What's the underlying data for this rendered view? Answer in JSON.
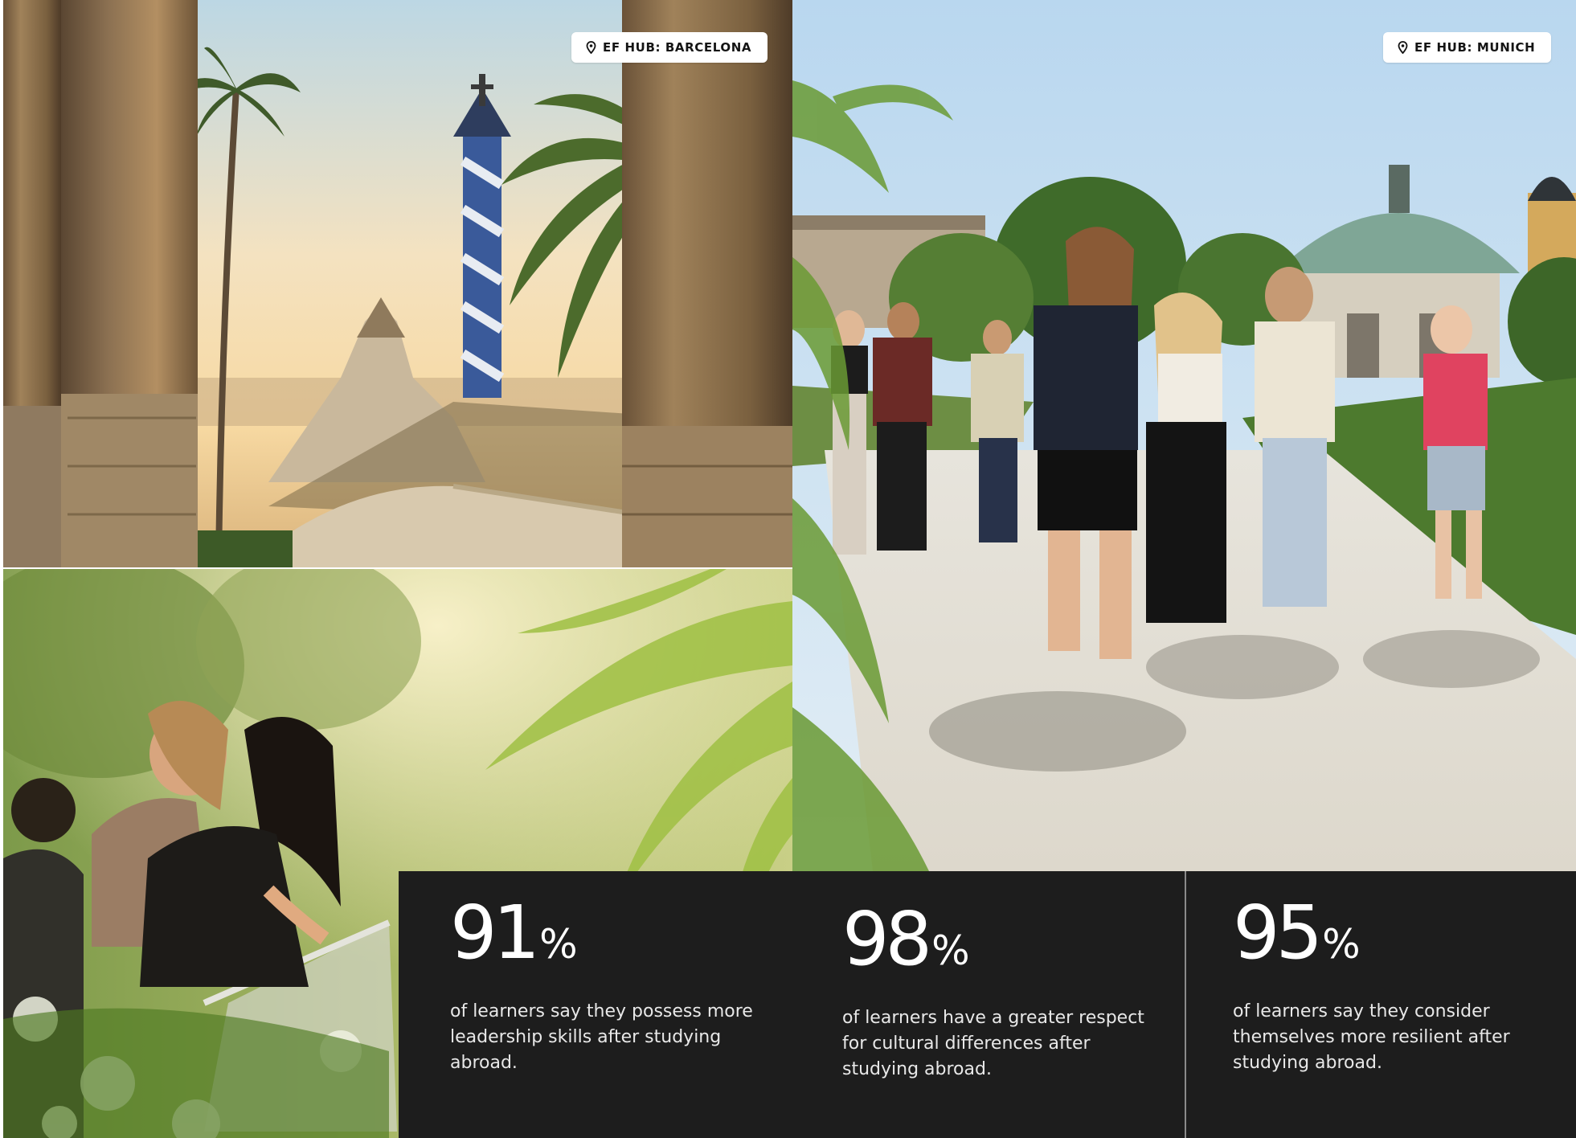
{
  "badges": {
    "barcelona": {
      "icon": "location-pin-icon",
      "label": "EF HUB: BARCELONA"
    },
    "munich": {
      "icon": "location-pin-icon",
      "label": "EF HUB: MUNICH"
    }
  },
  "colors": {
    "stats_background": "#1d1d1d",
    "stats_text": "#ffffff",
    "badge_background": "#ffffff",
    "badge_text": "#141414"
  },
  "stats": [
    {
      "number": "91",
      "unit": "%",
      "description": "of learners say they possess more leadership skills after studying abroad."
    },
    {
      "number": "98",
      "unit": "%",
      "description": "of learners have a greater respect for cultural differences after studying abroad."
    },
    {
      "number": "95",
      "unit": "%",
      "description": "of learners say they consider themselves more resilient after studying abroad."
    }
  ]
}
